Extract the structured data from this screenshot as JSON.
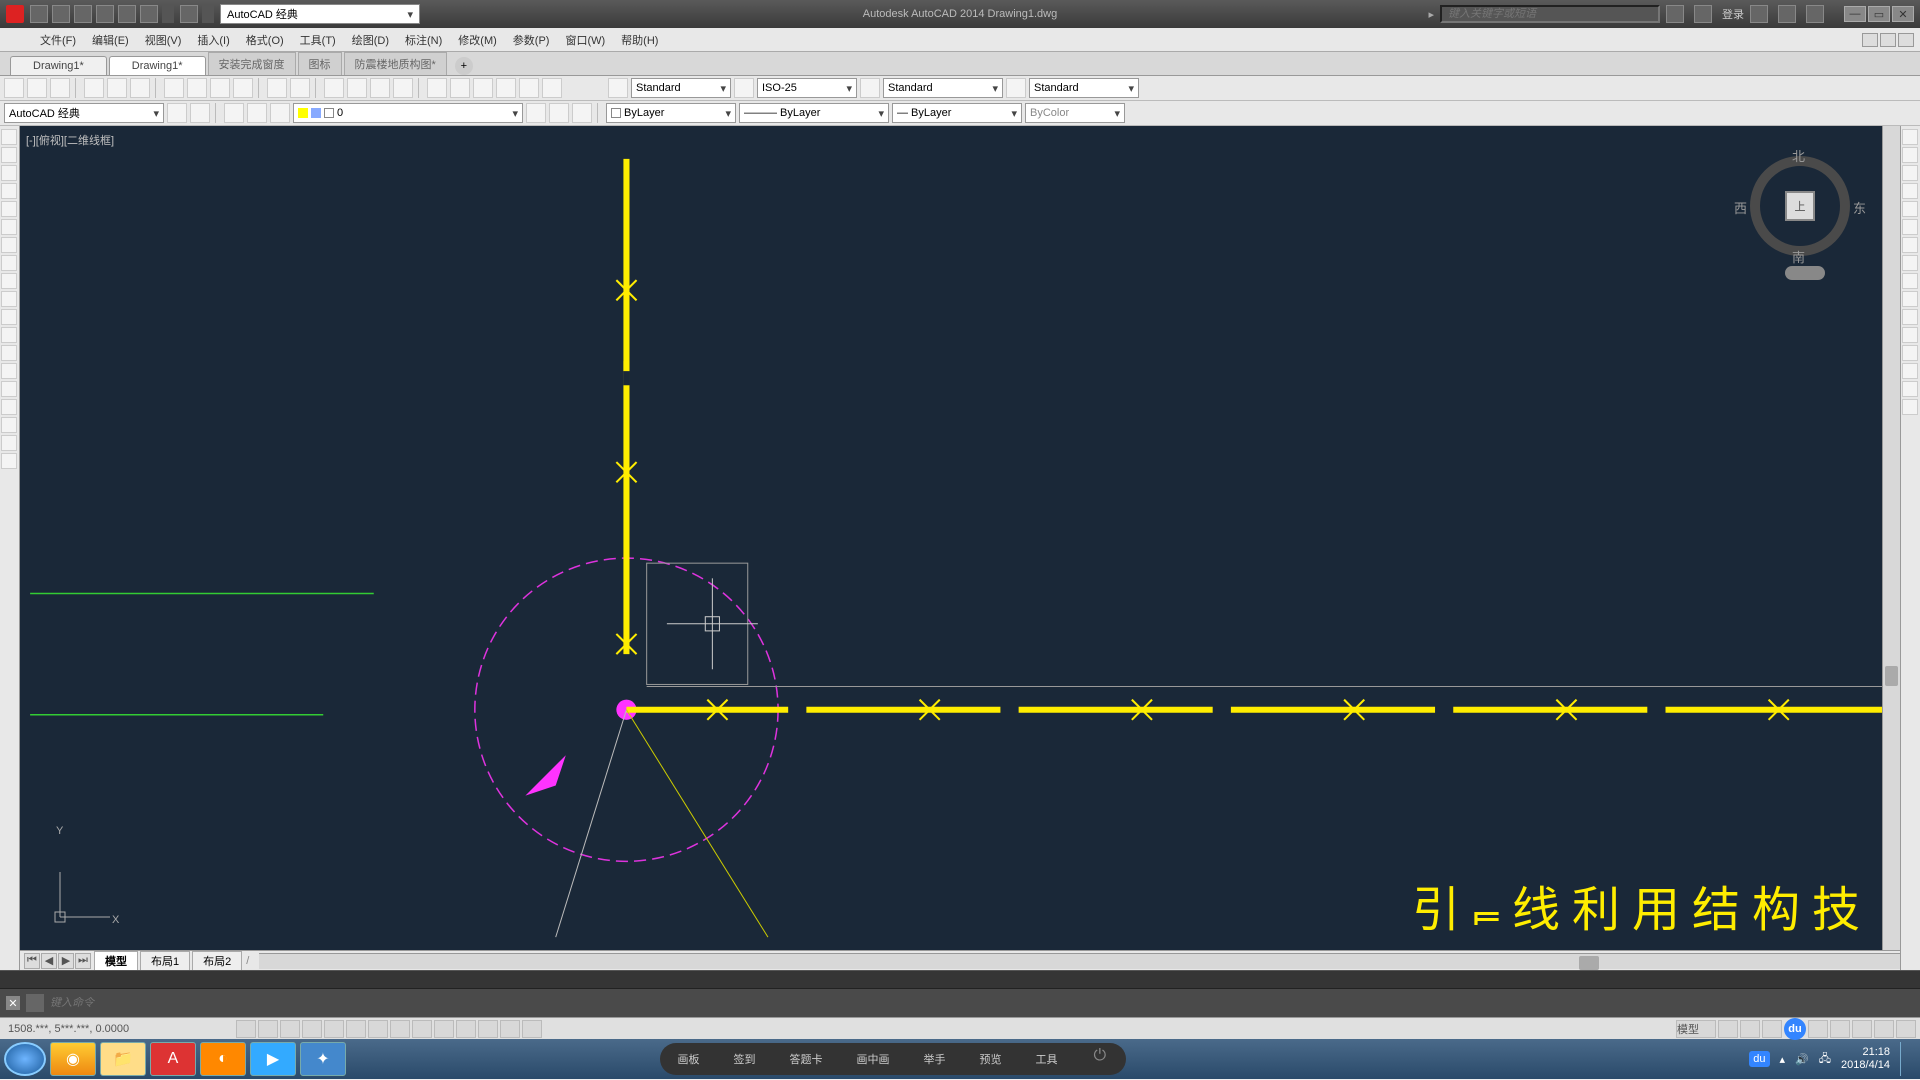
{
  "title_bar": {
    "workspace": "AutoCAD 经典",
    "app_title": "Autodesk AutoCAD 2014   Drawing1.dwg",
    "search_placeholder": "键入关键字或短语",
    "user_label": "登录"
  },
  "menus": [
    "文件(F)",
    "编辑(E)",
    "视图(V)",
    "插入(I)",
    "格式(O)",
    "工具(T)",
    "绘图(D)",
    "标注(N)",
    "修改(M)",
    "参数(P)",
    "窗口(W)",
    "帮助(H)"
  ],
  "doc_tabs": {
    "tabs": [
      "Drawing1*",
      "Drawing1*"
    ],
    "ext": [
      "安装完成窗度",
      "图标",
      "防震楼地质构图*"
    ],
    "active_index": 1
  },
  "toolbar2": {
    "text_style": "Standard",
    "dim_style": "ISO-25",
    "table_style": "Standard",
    "ml_style": "Standard"
  },
  "toolbar3": {
    "workspace": "AutoCAD 经典",
    "layer": "0",
    "color": "ByLayer",
    "linetype": "ByLayer",
    "lineweight": "ByLayer",
    "plotstyle": "ByColor"
  },
  "canvas": {
    "view_label": "[-][俯视][二维线框]",
    "viewcube": {
      "n": "北",
      "s": "南",
      "e": "东",
      "w": "西",
      "face": "上"
    },
    "ucs": {
      "x": "X",
      "y": "Y"
    },
    "annotation": "引 ⫭ 线     利 用 结 构 技"
  },
  "layout_tabs": {
    "tabs": [
      "模型",
      "布局1",
      "布局2"
    ],
    "active": 0
  },
  "command": {
    "placeholder": "键入命令"
  },
  "status": {
    "coords": "1508.***, 5***.***,  0.0000",
    "right_labels": [
      "模型"
    ]
  },
  "floating_toolbar": {
    "items": [
      "画板",
      "签到",
      "答题卡",
      "画中画",
      "举手",
      "预览",
      "工具"
    ]
  },
  "taskbar": {
    "time": "21:18",
    "date": "2018/4/14"
  },
  "chart_data": null
}
